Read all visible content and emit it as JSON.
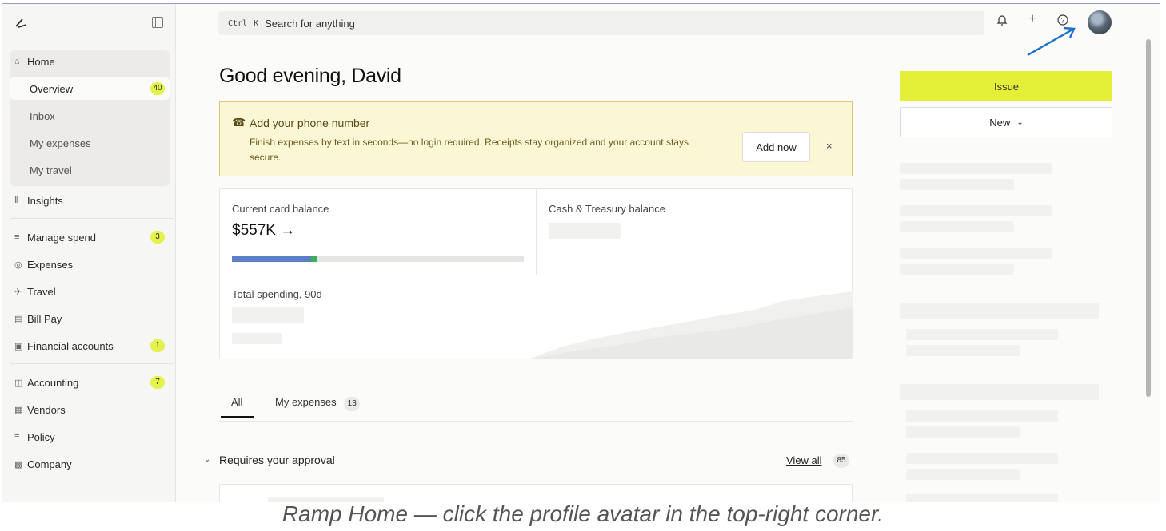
{
  "search": {
    "kbd_ctrl": "Ctrl",
    "kbd_k": "K",
    "placeholder": "Search for anything"
  },
  "top_icons": [
    "bell-icon",
    "plus-icon",
    "help-icon"
  ],
  "sidebar": {
    "items": [
      {
        "label": "Home",
        "icon": "home-icon"
      },
      {
        "label": "Overview",
        "badge": "40"
      },
      {
        "label": "Inbox"
      },
      {
        "label": "My expenses"
      },
      {
        "label": "My travel"
      },
      {
        "label": "Insights",
        "icon": "insights-icon"
      },
      {
        "label": "Manage spend",
        "icon": "layers-icon",
        "badge": "3"
      },
      {
        "label": "Expenses",
        "icon": "expenses-icon"
      },
      {
        "label": "Travel",
        "icon": "travel-icon"
      },
      {
        "label": "Bill Pay",
        "icon": "bill-icon"
      },
      {
        "label": "Financial accounts",
        "icon": "bank-icon",
        "badge": "1"
      },
      {
        "label": "Accounting",
        "icon": "accounting-icon",
        "badge": "7"
      },
      {
        "label": "Vendors",
        "icon": "vendors-icon"
      },
      {
        "label": "Policy",
        "icon": "policy-icon"
      },
      {
        "label": "Company",
        "icon": "company-icon"
      }
    ]
  },
  "main": {
    "greeting": "Good evening, David",
    "banner": {
      "title": "Add your phone number",
      "body": "Finish expenses by text in seconds—no login required. Receipts stay organized and your account stays secure.",
      "action": "Add now",
      "close": "×"
    },
    "cards": {
      "card_balance_label": "Current card balance",
      "card_balance_value": "$557K →",
      "card_balance_fill_fraction": 0.27,
      "cash_label": "Cash & Treasury balance",
      "spending_label": "Total spending, 90d"
    },
    "tabs": [
      {
        "label": "All"
      },
      {
        "label": "My expenses",
        "count": "13"
      }
    ],
    "approval": {
      "label": "Requires your approval",
      "view_all": "View all",
      "count": "85"
    }
  },
  "right_rail": {
    "issue": "Issue",
    "new": "New"
  },
  "colors": {
    "accent": "#e4f038",
    "badge": "#e4f24b",
    "bar": "#5b7fc7",
    "banner_bg": "#fbf6d4"
  },
  "caption": "Ramp Home — click the profile avatar in the top-right corner."
}
